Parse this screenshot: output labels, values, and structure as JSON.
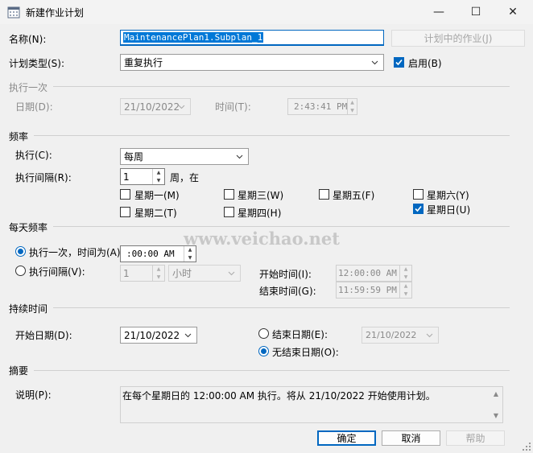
{
  "window": {
    "title": "新建作业计划",
    "icon": "calendar-icon",
    "controls": {
      "minimize": "—",
      "maximize": "☐",
      "close": "✕"
    }
  },
  "name": {
    "label": "名称(N):",
    "value": "MaintenancePlan1.Subplan_1",
    "jobs_button": "计划中的作业(J)"
  },
  "schedule_type": {
    "label": "计划类型(S):",
    "value": "重复执行",
    "enabled_label": "启用(B)",
    "enabled": true
  },
  "one_time": {
    "heading": "执行一次",
    "date_label": "日期(D):",
    "date_value": "21/10/2022",
    "time_label": "时间(T):",
    "time_value": "2:43:41 PM"
  },
  "frequency": {
    "heading": "频率",
    "occurs_label": "执行(C):",
    "occurs_value": "每周",
    "recur_label": "执行间隔(R):",
    "recur_value": "1",
    "recur_unit": "周，在",
    "days": [
      {
        "label": "星期一(M)",
        "checked": false
      },
      {
        "label": "星期三(W)",
        "checked": false
      },
      {
        "label": "星期五(F)",
        "checked": false
      },
      {
        "label": "星期六(Y)",
        "checked": false
      },
      {
        "label": "星期二(T)",
        "checked": false
      },
      {
        "label": "星期四(H)",
        "checked": false
      },
      {
        "label": "星期日(U)",
        "checked": true
      }
    ]
  },
  "daily": {
    "heading": "每天频率",
    "once_label": "执行一次，时间为(A):",
    "once_value": ":00:00 AM",
    "every_label": "执行间隔(V):",
    "every_value": "1",
    "every_unit": "小时",
    "start_label": "开始时间(I):",
    "start_value": "12:00:00 AM",
    "end_label": "结束时间(G):",
    "end_value": "11:59:59 PM"
  },
  "duration": {
    "heading": "持续时间",
    "start_label": "开始日期(D):",
    "start_value": "21/10/2022",
    "end_label": "结束日期(E):",
    "end_value": "21/10/2022",
    "no_end_label": "无结束日期(O):"
  },
  "summary": {
    "heading": "摘要",
    "desc_label": "说明(P):",
    "desc_value": "在每个星期日的 12:00:00 AM 执行。将从 21/10/2022 开始使用计划。"
  },
  "buttons": {
    "ok": "确定",
    "cancel": "取消",
    "help": "帮助"
  },
  "watermark": "www.veichao.net"
}
